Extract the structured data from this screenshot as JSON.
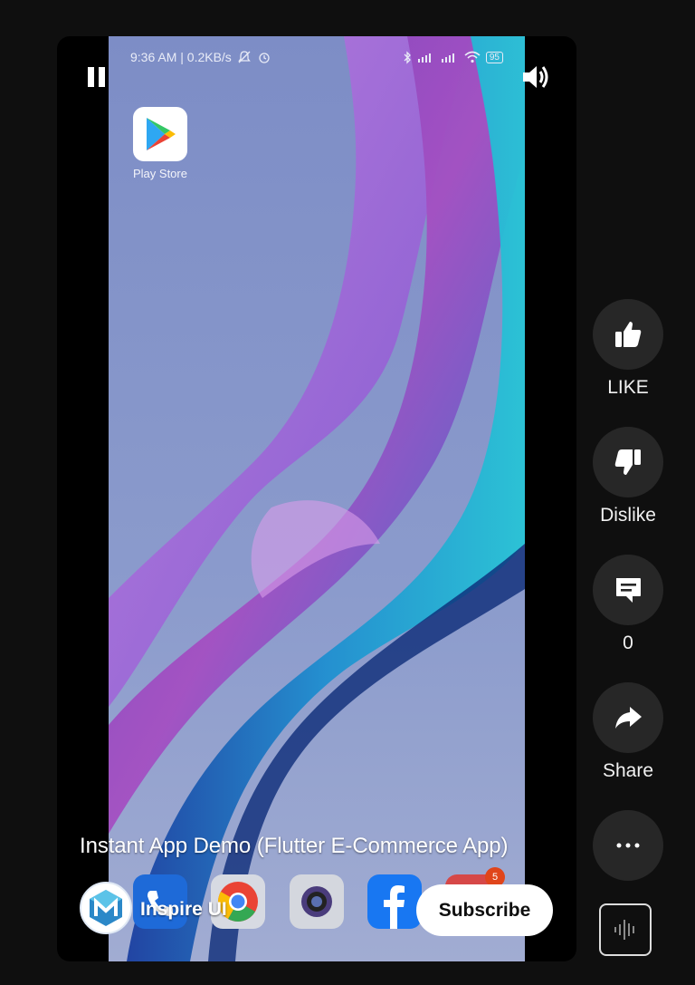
{
  "status_bar": {
    "time_speed": "9:36 AM | 0.2KB/s",
    "battery": "95"
  },
  "home": {
    "app_label": "Play Store",
    "notification_badge": "5"
  },
  "video": {
    "title": "Instant App Demo (Flutter E-Commerce App)",
    "channel": "Inspire UI",
    "subscribe_label": "Subscribe"
  },
  "actions": {
    "like_label": "LIKE",
    "dislike_label": "Dislike",
    "comments_count": "0",
    "share_label": "Share"
  },
  "icons": {
    "pause": "pause-icon",
    "volume": "volume-icon",
    "like": "thumb-up-icon",
    "dislike": "thumb-down-icon",
    "comment": "comment-icon",
    "share": "share-icon",
    "more": "more-icon",
    "remix": "audio-waveform-icon"
  },
  "colors": {
    "page_bg": "#0f0f0f",
    "action_bg": "#272727",
    "subscribe_bg": "#ffffff",
    "badge": "#e0451b"
  }
}
